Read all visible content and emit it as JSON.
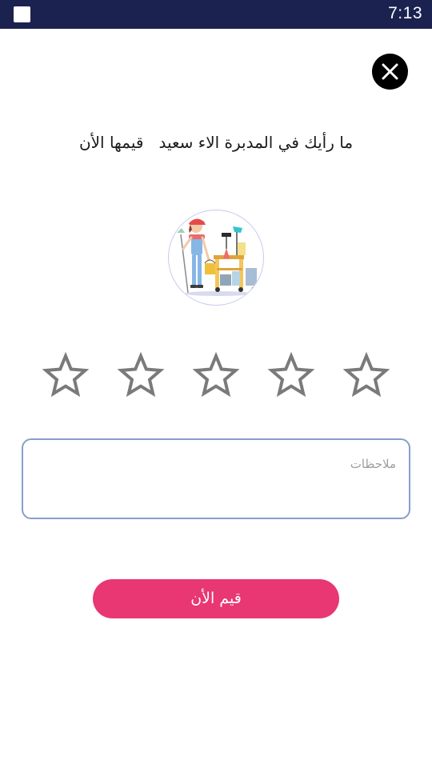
{
  "status_bar": {
    "time": "7:13"
  },
  "dialog": {
    "title": "ما رأيك في المدبرة الاء سعيد   قيمها الأن",
    "rating": {
      "max": 5,
      "value": 0
    },
    "notes": {
      "placeholder": "ملاحظات",
      "value": ""
    },
    "submit_label": "قيم الأن"
  },
  "colors": {
    "status_bar": "#1b2250",
    "accent": "#e83773",
    "star_outline": "#7a7a7a",
    "field_border": "#8a9cc9"
  },
  "icons": [
    "close-icon",
    "star-icon"
  ]
}
